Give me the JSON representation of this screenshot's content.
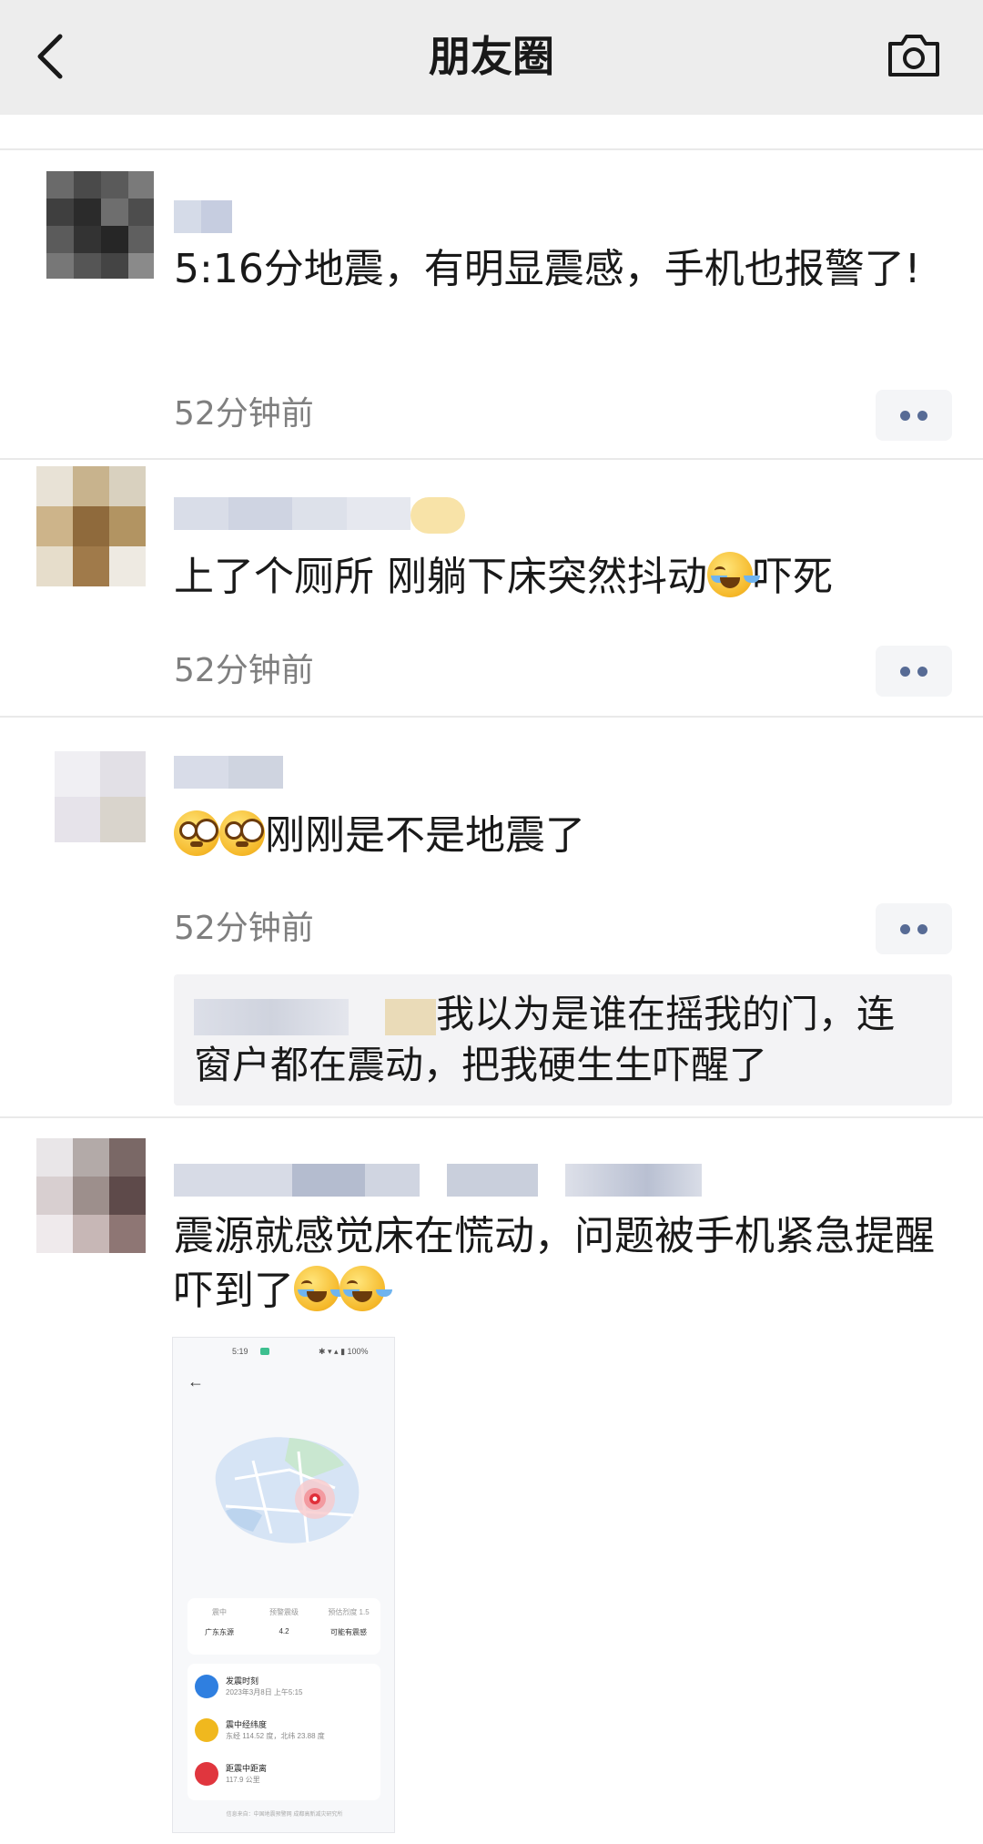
{
  "header": {
    "title": "朋友圈",
    "back_icon": "chevron-left-icon",
    "camera_icon": "camera-icon",
    "background": "#ededed"
  },
  "posts": [
    {
      "text": "5:16分地震，有明显震感，手机也报警了!",
      "time": "52分钟前"
    },
    {
      "text_before": "上了个厕所 刚躺下床突然抖动",
      "emoji": "crying-laughing-emoji",
      "text_after": "吓死",
      "time": "52分钟前"
    },
    {
      "emoji": "flushed-emoji",
      "text_after": "刚刚是不是地震了",
      "time": "52分钟前",
      "comment": "我以为是谁在摇我的门，连窗户都在震动，把我硬生生吓醒了"
    },
    {
      "text": "震源就感觉床在慌动，问题被手机紧急提醒吓到了",
      "emoji": "crying-laughing-emoji",
      "image": {
        "status_time": "5:19",
        "battery": "100%",
        "stat_labels": [
          "震中",
          "预警震级",
          "预估烈度 1.5"
        ],
        "stat_values": [
          "广东东源",
          "4.2",
          "可能有震感"
        ],
        "rows": [
          {
            "title": "发震时刻",
            "sub": "2023年3月8日 上午5:15"
          },
          {
            "title": "震中经纬度",
            "sub": "东经 114.52 度，北纬 23.88 度"
          },
          {
            "title": "距震中距离",
            "sub": "117.9 公里"
          }
        ],
        "footer": "信息来自：中国地震预警网 成都高新减灾研究所"
      }
    }
  ],
  "colors": {
    "link_blue": "#576b95",
    "time_gray": "#7f7f7f",
    "comment_bg": "#f3f3f5"
  }
}
